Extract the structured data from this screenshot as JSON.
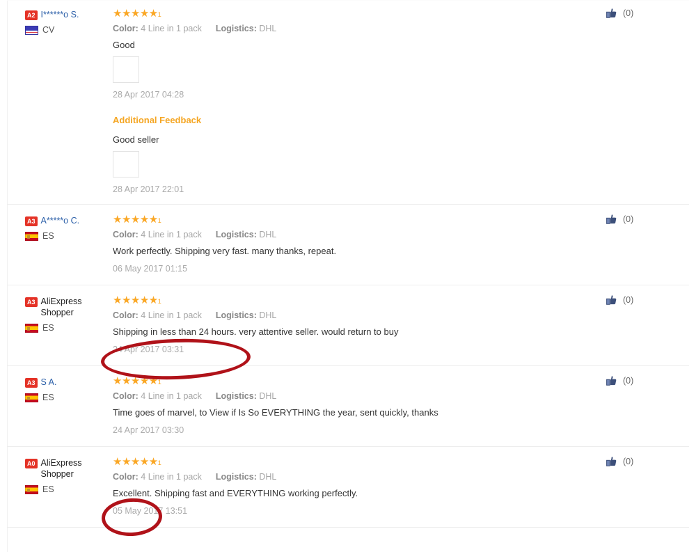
{
  "page": {
    "accent_orange": "#f5a623",
    "star_color": "#faa725",
    "badge_color": "#e43226",
    "link_color": "#2b5fa8",
    "annotation_color": "#b01219"
  },
  "labels": {
    "color_key": "Color:",
    "logistics_key": "Logistics:",
    "additional_feedback": "Additional Feedback"
  },
  "reviews": [
    {
      "badge": "A2",
      "user": "I******o S.",
      "country": "CV",
      "flag": "flag-cv-icon",
      "stars": "★★★★★",
      "star_count": "1",
      "color_value": "4 Line in 1 pack",
      "logistics_value": "DHL",
      "text": "Good",
      "image": "phone-photo-thumbnail",
      "timestamp": "28 Apr 2017 04:28",
      "helpful": "(0)",
      "additional": {
        "title": "Additional Feedback",
        "text": "Good seller",
        "image": "soccer-field-photo-thumbnail",
        "timestamp": "28 Apr 2017 22:01"
      }
    },
    {
      "badge": "A3",
      "user": "A*****o C.",
      "country": "ES",
      "flag": "flag-es-icon",
      "stars": "★★★★★",
      "star_count": "1",
      "color_value": "4 Line in 1 pack",
      "logistics_value": "DHL",
      "text": "Work perfectly. Shipping very fast. many thanks, repeat.",
      "timestamp": "06 May 2017 01:15",
      "helpful": "(0)"
    },
    {
      "badge": "A3",
      "user": "AliExpress Shopper",
      "country": "ES",
      "flag": "flag-es-icon",
      "stars": "★★★★★",
      "star_count": "1",
      "color_value": "4 Line in 1 pack",
      "logistics_value": "DHL",
      "text": "Shipping in less than 24 hours. very attentive seller. would return to buy",
      "timestamp": "24 Apr 2017 03:31",
      "helpful": "(0)"
    },
    {
      "badge": "A3",
      "user": "S A.",
      "country": "ES",
      "flag": "flag-es-icon",
      "stars": "★★★★★",
      "star_count": "1",
      "color_value": "4 Line in 1 pack",
      "logistics_value": "DHL",
      "text": "Time goes of marvel, to View if Is So EVERYTHING the year, sent quickly, thanks",
      "timestamp": "24 Apr 2017 03:30",
      "helpful": "(0)"
    },
    {
      "badge": "A0",
      "user": "AliExpress Shopper",
      "country": "ES",
      "flag": "flag-es-icon",
      "stars": "★★★★★",
      "star_count": "1",
      "color_value": "4 Line in 1 pack",
      "logistics_value": "DHL",
      "text": "Excellent. Shipping fast and EVERYTHING working perfectly.",
      "timestamp": "05 May 2017 13:51",
      "helpful": "(0)"
    }
  ]
}
